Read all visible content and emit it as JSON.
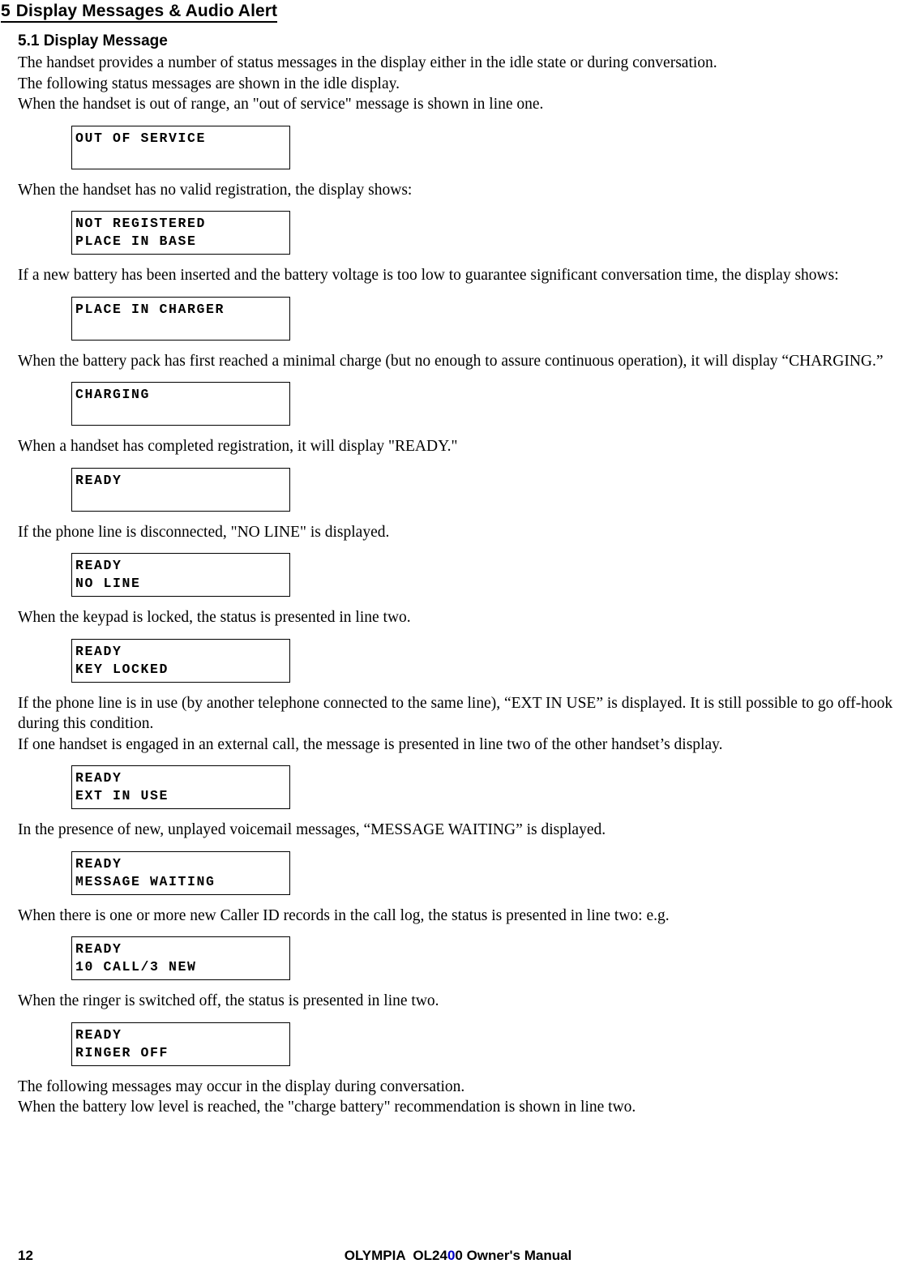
{
  "document": {
    "heading_number": "5",
    "heading_title": "Display Messages & Audio Alert",
    "subheading": "5.1 Display Message"
  },
  "paragraphs": {
    "p1": "The handset provides a number of status messages in the display either in the idle state or during conversation.",
    "p2": "The following status messages are shown in the idle display.",
    "p3": "When the handset is out of range, an \"out of service\" message is shown in line one.",
    "p4": "When the handset has no valid registration, the display shows:",
    "p5": "If a new battery has been inserted and the battery voltage is too low to guarantee significant conversation time, the display shows:",
    "p6": "When the battery pack has first reached a minimal charge (but no enough to assure continuous operation), it will display “CHARGING.”",
    "p7": "When a handset has completed registration, it will display \"READY.\"",
    "p8": "If the phone line is disconnected, \"NO LINE\" is displayed.",
    "p9": "When the keypad is locked, the status is presented in line two.",
    "p10": "If the phone line is in use (by another telephone connected to the same line), “EXT IN USE” is displayed. It is still possible to go off-hook during this condition.",
    "p11": "If one handset is engaged in an external call, the message is presented in line two of the other handset’s display.",
    "p12": "In the presence of new, unplayed voicemail messages, “MESSAGE WAITING” is displayed.",
    "p13": "When there is one or more new Caller ID records in the call log, the status is presented in line two: e.g.",
    "p14": "When the ringer is switched off, the status is presented in line two.",
    "p15": "The following messages may occur in the display during conversation.",
    "p16": "When the battery low level is reached, the \"charge battery\" recommendation is shown in line two."
  },
  "lcd_displays": [
    {
      "line1": "OUT OF SERVICE",
      "line2": ""
    },
    {
      "line1": "NOT REGISTERED",
      "line2": "PLACE IN BASE"
    },
    {
      "line1": "PLACE IN CHARGER",
      "line2": ""
    },
    {
      "line1": "CHARGING",
      "line2": ""
    },
    {
      "line1": "READY",
      "line2": ""
    },
    {
      "line1": "READY",
      "line2": "NO LINE"
    },
    {
      "line1": "READY",
      "line2": "KEY LOCKED"
    },
    {
      "line1": "READY",
      "line2": "EXT IN USE"
    },
    {
      "line1": "READY",
      "line2": "MESSAGE WAITING"
    },
    {
      "line1": "READY",
      "line2": "10 CALL/3 NEW"
    },
    {
      "line1": "READY",
      "line2": "RINGER OFF"
    }
  ],
  "footer": {
    "page_number": "12",
    "manual_prefix": "OLYMPIA  OL24",
    "manual_blue_digit": "0",
    "manual_suffix": "0 Owner's Manual",
    "blue_color": "#0000c8"
  }
}
